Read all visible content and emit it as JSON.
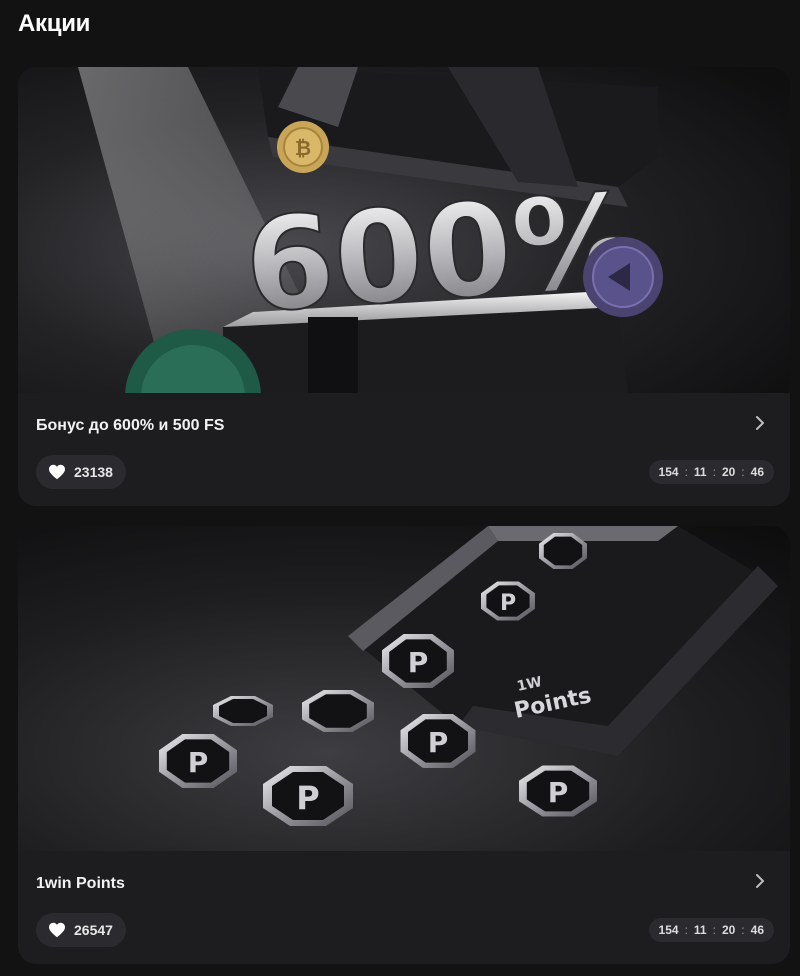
{
  "page": {
    "title": "Акции"
  },
  "promotions": [
    {
      "title": "Бонус до 600% и 500 FS",
      "banner_text": "600%",
      "likes": "23138",
      "timer": {
        "days": "154",
        "hours": "11",
        "minutes": "20",
        "seconds": "46"
      }
    },
    {
      "title": "1win Points",
      "banner_brand": "1W",
      "banner_text": "Points",
      "banner_coin_letter": "P",
      "likes": "26547",
      "timer": {
        "days": "154",
        "hours": "11",
        "minutes": "20",
        "seconds": "46"
      }
    }
  ],
  "colors": {
    "background": "#121213",
    "card": "#1d1d20",
    "pill": "#2b2b2f",
    "text": "#ffffff"
  },
  "icons": {
    "like": "heart-icon",
    "open": "chevron-right-icon"
  }
}
